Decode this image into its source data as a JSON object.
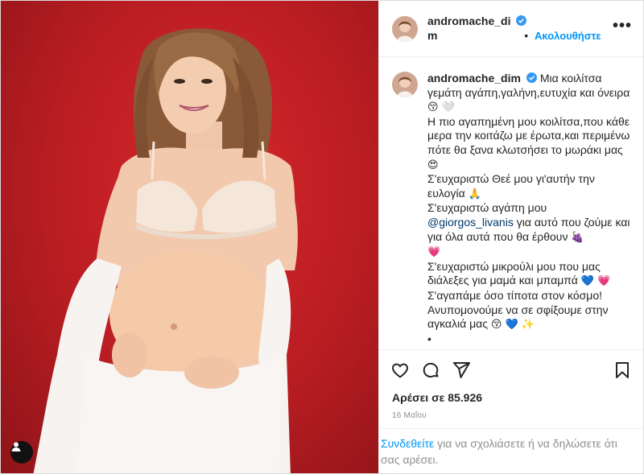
{
  "post": {
    "username": "andromache_dim",
    "username_wrapped_a": "andromache_di",
    "username_wrapped_b": "m",
    "verified": true,
    "follow_label": "Ακολουθήστε",
    "more_label": "•••",
    "caption": {
      "line1": "Μια κοιλίτσα γεμάτη αγάπη,γαλήνη,ευτυχία και όνειρα",
      "line2": "Η πιο αγαπημένη μου κοιλίτσα,που κάθε μερα την κοιτάζω με έρωτα,και περιμένω πότε θα ξανα κλωτσήσει το μωράκι μας",
      "line3": "Σ'ευχαριστώ Θεέ μου γι'αυτήν την ευλογία",
      "line4a": "Σ'ευχαριστώ αγάπη μου",
      "mention": "@giorgos_livanis",
      "line4b": "για αυτό που ζούμε και για όλα αυτά που θα έρθουν",
      "line5": "Σ'ευχαριστώ μικρούλι μου που μας διάλεξες για μαμά και μπαμπά",
      "line6": "Σ'αγαπάμε όσο τίποτα στον κόσμο!",
      "line7": "Ανυπομονούμε να σε σφίξουμε στην αγκαλιά μας",
      "bullet1": "•",
      "bullet2": "•"
    },
    "likes_label": "Αρέσει σε 85.926",
    "date": "16 Μαΐου",
    "login_link": "Συνδεθείτε",
    "login_text": "για να σχολιάσετε ή να δηλώσετε ότι σας αρέσει."
  },
  "colors": {
    "background_red": "#c4232a",
    "link_blue": "#0095f6",
    "verified_blue": "#3897f0",
    "mention_blue": "#00376b"
  },
  "icons": [
    "verified-badge-icon",
    "more-options-icon",
    "heart-icon",
    "comment-icon",
    "share-icon",
    "bookmark-icon",
    "tagged-user-icon"
  ]
}
